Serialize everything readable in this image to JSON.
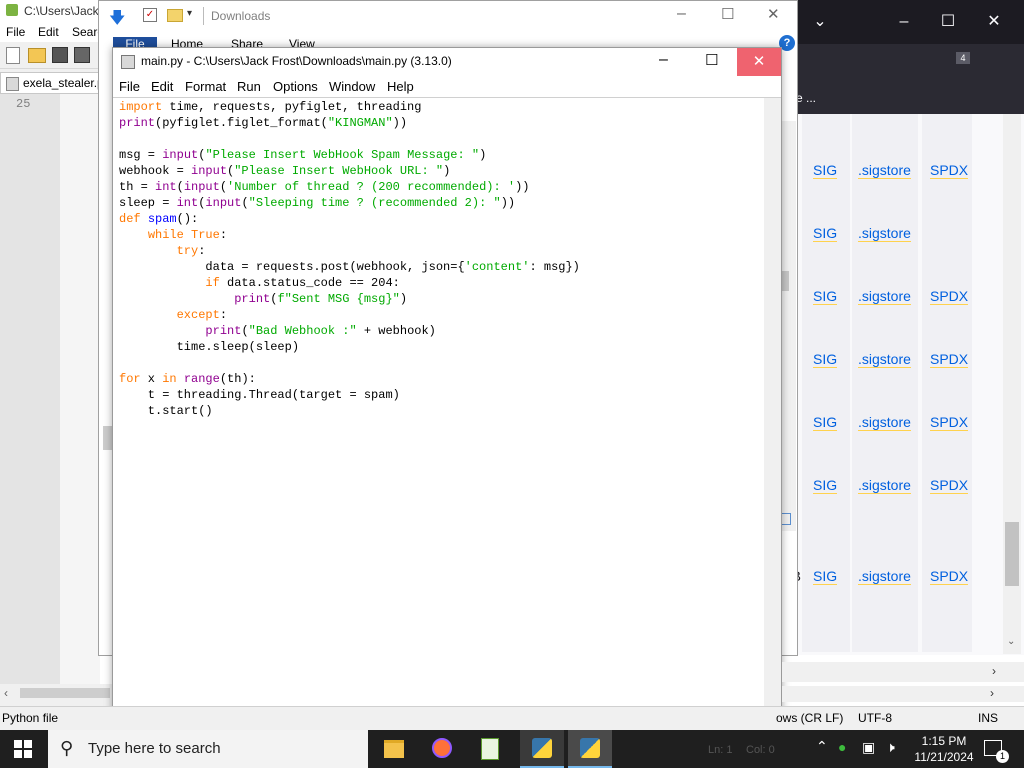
{
  "npp": {
    "title": "C:\\Users\\Jack",
    "menu": [
      "File",
      "Edit",
      "Searc"
    ],
    "tab": "exela_stealer.p",
    "line_number": "25",
    "status_type": "Python file",
    "status_eol": "ows (CR LF)",
    "status_encoding": "UTF-8",
    "status_ins": "INS"
  },
  "explorer": {
    "title": "Downloads",
    "ribbon_tabs": [
      "File",
      "Home",
      "Share",
      "View"
    ],
    "help_glyph": "?"
  },
  "firefox": {
    "bookmark_text": "e ...",
    "extension_badge": "4",
    "rows": [
      {
        "a": "SIG",
        "b": ".sigstore",
        "c": "SPDX"
      },
      {
        "a": "SIG",
        "b": ".sigstore",
        "c": ""
      },
      {
        "a": "SIG",
        "b": ".sigstore",
        "c": "SPDX"
      },
      {
        "a": "SIG",
        "b": ".sigstore",
        "c": "SPDX"
      },
      {
        "a": "SIG",
        "b": ".sigstore",
        "c": "SPDX"
      },
      {
        "a": "SIG",
        "b": ".sigstore",
        "c": "SPDX"
      },
      {
        "a": "SIG",
        "b": ".sigstore",
        "c": "SPDX"
      }
    ],
    "size_fragment": "MB"
  },
  "idle": {
    "title": "main.py - C:\\Users\\Jack Frost\\Downloads\\main.py (3.13.0)",
    "menu": [
      "File",
      "Edit",
      "Format",
      "Run",
      "Options",
      "Window",
      "Help"
    ],
    "code_lines": [
      "import time, requests, pyfiglet, threading",
      "print(pyfiglet.figlet_format(\"KINGMAN\"))",
      "",
      "msg = input(\"Please Insert WebHook Spam Message: \")",
      "webhook = input(\"Please Insert WebHook URL: \")",
      "th = int(input('Number of thread ? (200 recommended): '))",
      "sleep = int(input(\"Sleeping time ? (recommended 2): \"))",
      "def spam():",
      "    while True:",
      "        try:",
      "            data = requests.post(webhook, json={'content': msg})",
      "            if data.status_code == 204:",
      "                print(f\"Sent MSG {msg}\")",
      "        except:",
      "            print(\"Bad Webhook :\" + webhook)",
      "        time.sleep(sleep)",
      "",
      "for x in range(th):",
      "    t = threading.Thread(target = spam)",
      "    t.start()"
    ],
    "status_ln": "Ln: 1",
    "status_col": "Col: 0"
  },
  "taskbar": {
    "search_placeholder": "Type here to search",
    "time": "1:15 PM",
    "date": "11/21/2024",
    "notification_count": "1"
  },
  "colors": {
    "keyword": "#ff7700",
    "builtin": "#900090",
    "string": "#00aa00",
    "def_name": "#0000ff",
    "close_hover": "#e81123"
  }
}
